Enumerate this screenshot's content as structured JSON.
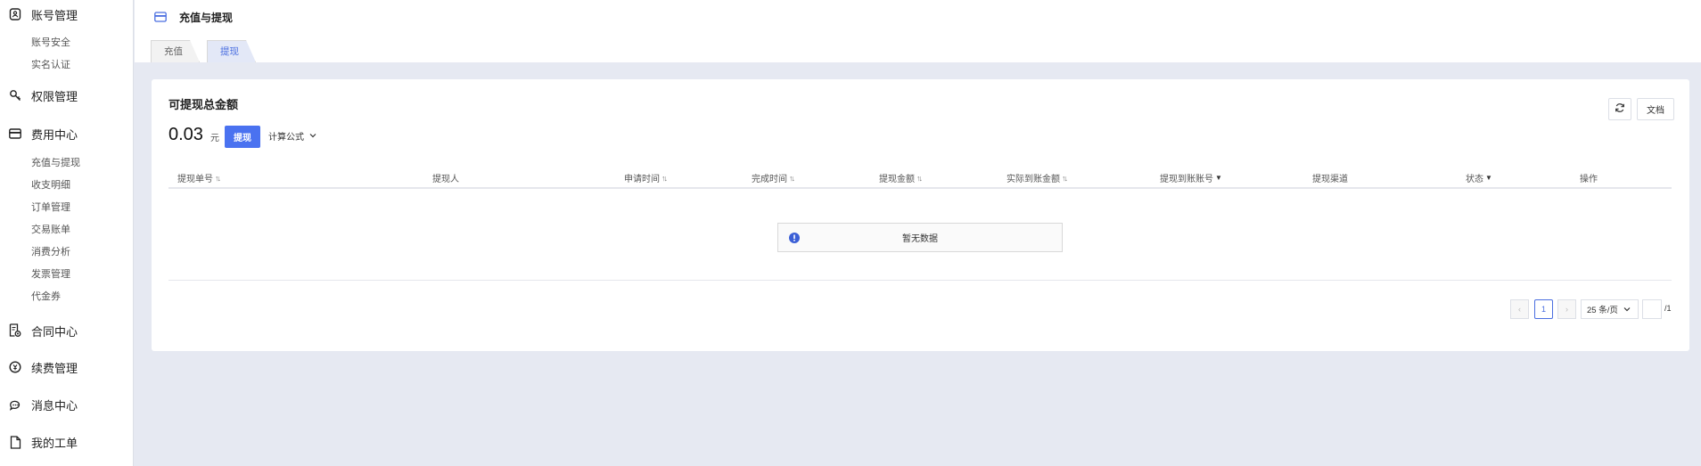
{
  "sidebar": {
    "groups": [
      {
        "label": "账号管理",
        "icon": "account-icon",
        "subs": [
          "账号安全",
          "实名认证"
        ]
      },
      {
        "label": "权限管理",
        "icon": "key-icon",
        "subs": []
      },
      {
        "label": "费用中心",
        "icon": "card-icon",
        "subs": [
          "充值与提现",
          "收支明细",
          "订单管理",
          "交易账单",
          "消费分析",
          "发票管理",
          "代金券"
        ]
      },
      {
        "label": "合同中心",
        "icon": "contract-icon",
        "subs": []
      },
      {
        "label": "续费管理",
        "icon": "renew-icon",
        "subs": []
      },
      {
        "label": "消息中心",
        "icon": "message-icon",
        "subs": []
      },
      {
        "label": "我的工单",
        "icon": "ticket-icon",
        "subs": []
      }
    ]
  },
  "header": {
    "title": "充值与提现",
    "tabs": [
      {
        "label": "充值"
      },
      {
        "label": "提现"
      }
    ],
    "active_tab": "提现"
  },
  "card": {
    "title": "可提现总金额",
    "amount": "0.03",
    "unit": "元",
    "withdraw_label": "提现",
    "formula_label": "计算公式",
    "doc_label": "文档"
  },
  "table": {
    "columns": [
      "提现单号",
      "提现人",
      "申请时间",
      "完成时间",
      "提现金额",
      "实际到账金额",
      "提现到账账号",
      "提现渠道",
      "状态",
      "操作"
    ],
    "empty_text": "暂无数据"
  },
  "pagination": {
    "current_page": "1",
    "page_size_label": "25 条/页",
    "total_pages": "/1"
  },
  "colors": {
    "accent": "#4a72f0",
    "background": "#e6e9f2"
  }
}
